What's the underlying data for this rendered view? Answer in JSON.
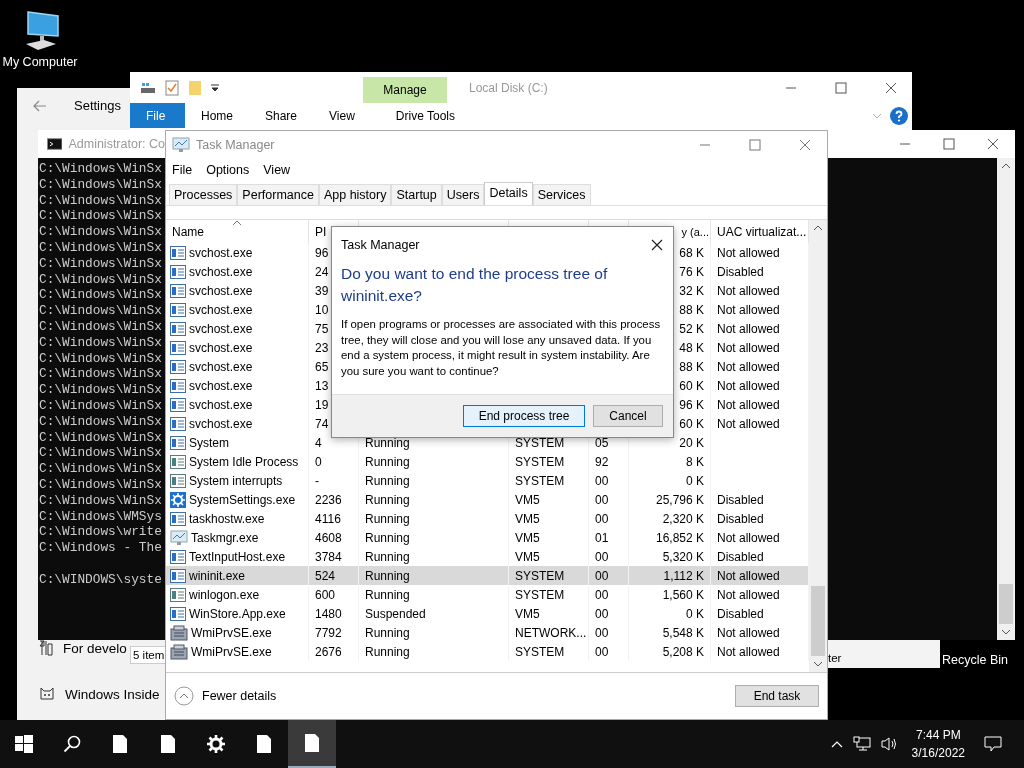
{
  "desktop_icons": [
    {
      "label": "My Computer",
      "kind": "computer"
    },
    {
      "label": "Recycle Bin",
      "kind": "bin"
    }
  ],
  "settings_window": {
    "title": "Settings",
    "items": [
      {
        "label": "For develo",
        "kind": "developer"
      },
      {
        "label": "Windows Inside",
        "kind": "insider"
      }
    ]
  },
  "explorer_window": {
    "title": "Local Disk (C:)",
    "context_tab": "Manage",
    "ribbon_tabs": [
      {
        "label": "File",
        "kind": "file"
      },
      {
        "label": "Home",
        "kind": "tab"
      },
      {
        "label": "Share",
        "kind": "tab"
      },
      {
        "label": "View",
        "kind": "tab"
      },
      {
        "label": "Drive Tools",
        "kind": "context"
      }
    ],
    "status_fragments": [
      "5 item",
      "ter"
    ]
  },
  "console_window": {
    "title": "Administrator: Co",
    "lines": [
      "C:\\Windows\\WinSx",
      "C:\\Windows\\WinSx",
      "C:\\Windows\\WinSx",
      "C:\\Windows\\WinSx",
      "C:\\Windows\\WinSx",
      "C:\\Windows\\WinSx",
      "C:\\Windows\\WinSx",
      "C:\\Windows\\WinSx",
      "C:\\Windows\\WinSx",
      "C:\\Windows\\WinSx",
      "C:\\Windows\\WinSx",
      "C:\\Windows\\WinSx",
      "C:\\Windows\\WinSx",
      "C:\\Windows\\WinSx",
      "C:\\Windows\\WinSx",
      "C:\\Windows\\WinSx",
      "C:\\Windows\\WinSx",
      "C:\\Windows\\WinSx",
      "C:\\Windows\\WinSx",
      "C:\\Windows\\WinSx",
      "C:\\Windows\\WinSx",
      "C:\\Windows\\WinSx",
      "C:\\Windows\\WMSys",
      "C:\\Windows\\write",
      "C:\\Windows - The"
    ],
    "prompt": "C:\\WINDOWS\\syste"
  },
  "task_manager": {
    "title": "Task Manager",
    "menu": [
      "File",
      "Options",
      "View"
    ],
    "tabs": [
      {
        "label": "Processes",
        "selected": false
      },
      {
        "label": "Performance",
        "selected": false
      },
      {
        "label": "App history",
        "selected": false
      },
      {
        "label": "Startup",
        "selected": false
      },
      {
        "label": "Users",
        "selected": false
      },
      {
        "label": "Details",
        "selected": true
      },
      {
        "label": "Services",
        "selected": false
      }
    ],
    "columns": [
      {
        "label": "Name",
        "sorted": true
      },
      {
        "label": "PI",
        "sorted": false
      },
      {
        "label": "y (a...",
        "sorted": false
      },
      {
        "label": "UAC virtualizat...",
        "sorted": false
      }
    ],
    "rows": [
      {
        "name": "svchost.exe",
        "pid": "96",
        "memory": "68 K",
        "uac": "Not allowed",
        "kind": "service",
        "selected": false
      },
      {
        "name": "svchost.exe",
        "pid": "24",
        "memory": "76 K",
        "uac": "Disabled",
        "kind": "service",
        "selected": false
      },
      {
        "name": "svchost.exe",
        "pid": "39",
        "memory": "32 K",
        "uac": "Not allowed",
        "kind": "service",
        "selected": false
      },
      {
        "name": "svchost.exe",
        "pid": "10",
        "memory": "88 K",
        "uac": "Not allowed",
        "kind": "service",
        "selected": false
      },
      {
        "name": "svchost.exe",
        "pid": "75",
        "memory": "52 K",
        "uac": "Not allowed",
        "kind": "service",
        "selected": false
      },
      {
        "name": "svchost.exe",
        "pid": "23",
        "memory": "48 K",
        "uac": "Not allowed",
        "kind": "service",
        "selected": false
      },
      {
        "name": "svchost.exe",
        "pid": "65",
        "memory": "88 K",
        "uac": "Not allowed",
        "kind": "service",
        "selected": false
      },
      {
        "name": "svchost.exe",
        "pid": "13",
        "memory": "60 K",
        "uac": "Not allowed",
        "kind": "service",
        "selected": false
      },
      {
        "name": "svchost.exe",
        "pid": "19",
        "memory": "96 K",
        "uac": "Not allowed",
        "kind": "service",
        "selected": false
      },
      {
        "name": "svchost.exe",
        "pid": "74",
        "memory": "60 K",
        "uac": "Not allowed",
        "kind": "service",
        "selected": false
      },
      {
        "name": "System",
        "pid": "4",
        "status": "Running",
        "user": "SYSTEM",
        "cpu": "05",
        "memory": "20 K",
        "kind": "service",
        "selected": false
      },
      {
        "name": "System Idle Process",
        "pid": "0",
        "status": "Running",
        "user": "SYSTEM",
        "cpu": "92",
        "memory": "8 K",
        "kind": "window",
        "selected": false
      },
      {
        "name": "System interrupts",
        "pid": "-",
        "status": "Running",
        "user": "SYSTEM",
        "cpu": "00",
        "memory": "0 K",
        "kind": "window",
        "selected": false
      },
      {
        "name": "SystemSettings.exe",
        "pid": "2236",
        "status": "Running",
        "user": "VM5",
        "cpu": "00",
        "memory": "25,796 K",
        "uac": "Disabled",
        "kind": "gear",
        "selected": false
      },
      {
        "name": "taskhostw.exe",
        "pid": "4116",
        "status": "Running",
        "user": "VM5",
        "cpu": "00",
        "memory": "2,320 K",
        "uac": "Disabled",
        "kind": "service",
        "selected": false
      },
      {
        "name": "Taskmgr.exe",
        "pid": "4608",
        "status": "Running",
        "user": "VM5",
        "cpu": "01",
        "memory": "16,852 K",
        "uac": "Not allowed",
        "kind": "monitor",
        "selected": false
      },
      {
        "name": "TextInputHost.exe",
        "pid": "3784",
        "status": "Running",
        "user": "VM5",
        "cpu": "00",
        "memory": "5,320 K",
        "uac": "Disabled",
        "kind": "service",
        "selected": false
      },
      {
        "name": "wininit.exe",
        "pid": "524",
        "status": "Running",
        "user": "SYSTEM",
        "cpu": "00",
        "memory": "1,112 K",
        "uac": "Not allowed",
        "kind": "service",
        "selected": true
      },
      {
        "name": "winlogon.exe",
        "pid": "600",
        "status": "Running",
        "user": "SYSTEM",
        "cpu": "00",
        "memory": "1,560 K",
        "uac": "Not allowed",
        "kind": "window",
        "selected": false
      },
      {
        "name": "WinStore.App.exe",
        "pid": "1480",
        "status": "Suspended",
        "user": "VM5",
        "cpu": "00",
        "memory": "0 K",
        "uac": "Disabled",
        "kind": "service",
        "selected": false
      },
      {
        "name": "WmiPrvSE.exe",
        "pid": "7792",
        "status": "Running",
        "user": "NETWORK...",
        "cpu": "00",
        "memory": "5,548 K",
        "uac": "Not allowed",
        "kind": "machine",
        "selected": false
      },
      {
        "name": "WmiPrvSE.exe",
        "pid": "2676",
        "status": "Running",
        "user": "SYSTEM",
        "cpu": "00",
        "memory": "5,208 K",
        "uac": "Not allowed",
        "kind": "machine",
        "selected": false
      }
    ],
    "footer": {
      "toggle": "Fewer details",
      "end_task": "End task"
    }
  },
  "dialog": {
    "title": "Task Manager",
    "heading": "Do you want to end the process tree of wininit.exe?",
    "message": "If open programs or processes are associated with this process tree, they will close and you will lose any unsaved data. If you end a system process, it might result in system instability. Are you sure you want to continue?",
    "buttons": [
      {
        "label": "End process tree",
        "kind": "default"
      },
      {
        "label": "Cancel",
        "kind": "normal"
      }
    ]
  },
  "taskbar": {
    "apps": [
      {
        "kind": "file",
        "selected": false
      },
      {
        "kind": "file",
        "selected": false
      },
      {
        "kind": "gear",
        "selected": false
      },
      {
        "kind": "file",
        "selected": false
      },
      {
        "kind": "file",
        "selected": true
      }
    ],
    "time": "7:44 PM",
    "date": "3/16/2022"
  }
}
